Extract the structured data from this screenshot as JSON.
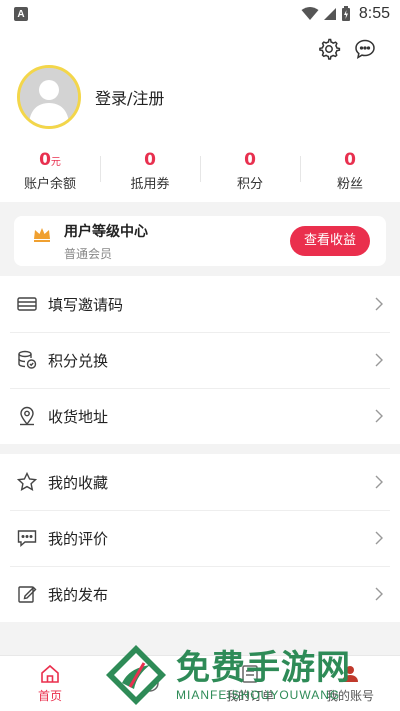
{
  "status_bar": {
    "time": "8:55",
    "left_badge": "A"
  },
  "header": {
    "settings_icon": "gear-icon",
    "message_icon": "chat-bubble-icon"
  },
  "user": {
    "login_label": "登录/注册"
  },
  "stats": [
    {
      "value": "0",
      "unit": "元",
      "label": "账户余额"
    },
    {
      "value": "0",
      "unit": "",
      "label": "抵用券"
    },
    {
      "value": "0",
      "unit": "",
      "label": "积分"
    },
    {
      "value": "0",
      "unit": "",
      "label": "粉丝"
    }
  ],
  "level_card": {
    "title": "用户等级中心",
    "subtitle": "普通会员",
    "button_label": "查看收益",
    "icon": "crown-icon"
  },
  "menu_group_1": [
    {
      "label": "填写邀请码",
      "icon": "ticket-icon"
    },
    {
      "label": "积分兑换",
      "icon": "coins-icon"
    },
    {
      "label": "收货地址",
      "icon": "location-pin-icon"
    }
  ],
  "menu_group_2": [
    {
      "label": "我的收藏",
      "icon": "star-icon"
    },
    {
      "label": "我的评价",
      "icon": "comment-icon"
    },
    {
      "label": "我的发布",
      "icon": "edit-icon"
    }
  ],
  "tabs": [
    {
      "label": "首页",
      "icon": "home-icon",
      "active": true
    },
    {
      "label": "",
      "icon": "circle-icon",
      "active": false
    },
    {
      "label": "我的订单",
      "icon": "order-icon",
      "active": false
    },
    {
      "label": "我的账号",
      "icon": "user-icon",
      "active": false
    }
  ],
  "watermark": {
    "title": "免费手游网",
    "subtitle": "MIANFEISHOUYOUWANG"
  },
  "colors": {
    "accent": "#ea2f4d",
    "avatar_ring": "#f3d64a",
    "crown": "#f0a030",
    "watermark": "#2e8b57"
  }
}
